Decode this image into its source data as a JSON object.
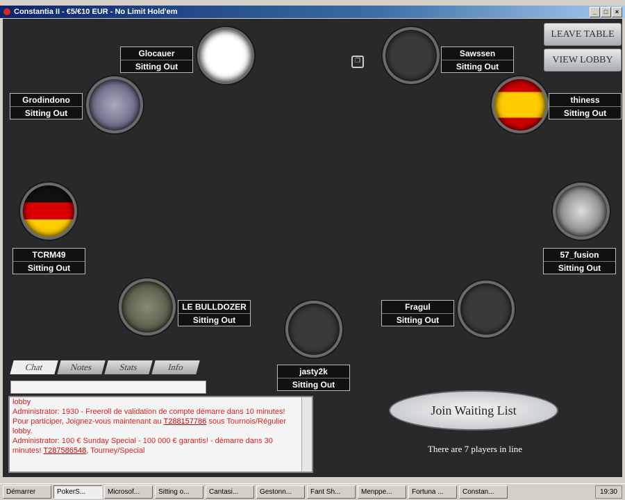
{
  "window": {
    "title": "Constantia II - €5/€10 EUR - No Limit Hold'em"
  },
  "buttons": {
    "leave": "LEAVE TABLE",
    "lobby": "VIEW LOBBY",
    "join": "Join Waiting List"
  },
  "waiting_text": "There are 7 players in line",
  "seats": [
    {
      "name": "Glocauer",
      "status": "Sitting Out",
      "avatar": "arjel-logo"
    },
    {
      "name": "Grodindono",
      "status": "Sitting Out",
      "avatar": "photo"
    },
    {
      "name": "TCRM49",
      "status": "Sitting Out",
      "avatar": "germany-flag"
    },
    {
      "name": "LE BULLDOZER",
      "status": "Sitting Out",
      "avatar": "bulldozer-photo"
    },
    {
      "name": "jasty2k",
      "status": "Sitting Out",
      "avatar": "empty"
    },
    {
      "name": "Fragul",
      "status": "Sitting Out",
      "avatar": "empty"
    },
    {
      "name": "57_fusion",
      "status": "Sitting Out",
      "avatar": "anime-character"
    },
    {
      "name": "thiness",
      "status": "Sitting Out",
      "avatar": "spain-flag"
    },
    {
      "name": "Sawssen",
      "status": "Sitting Out",
      "avatar": "empty"
    }
  ],
  "tabs": [
    "Chat",
    "Notes",
    "Stats",
    "Info"
  ],
  "chat": {
    "lines": [
      {
        "pre": "lobby",
        "link": "",
        "post": ""
      },
      {
        "pre": "Administrator: 1930 - Freeroll de validation de compte démarre dans 10 minutes! Pour participer, Joignez-vous maintenant au ",
        "link": "T288157786",
        "post": " sous Tournois/Régulier lobby."
      },
      {
        "pre": "Administrator: 100 € Sunday Special - 100 000 € garantis! - démarre dans 30 minutes! ",
        "link": "T287586548",
        "post": ", Tourney/Special"
      }
    ]
  },
  "taskbar": {
    "items": [
      "Démarrer",
      "PokerS...",
      "Microsof...",
      "Sitting o...",
      "Cantasi...",
      "Gestonn...",
      "Fant Sh...",
      "Menppe...",
      "Fortuna ...",
      "Constan..."
    ],
    "clock": "19:30"
  }
}
